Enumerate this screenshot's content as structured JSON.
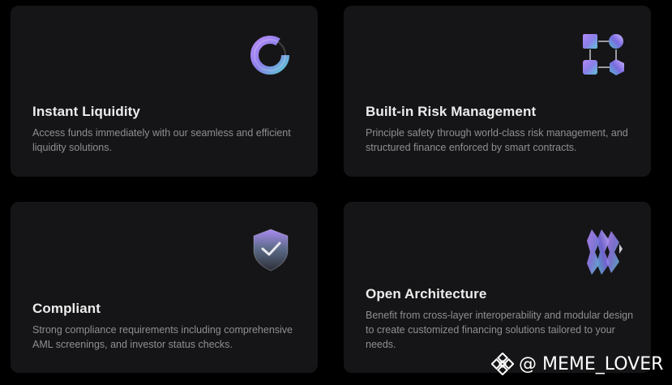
{
  "cards": [
    {
      "icon": "liquidity-ring-icon",
      "title": "Instant Liquidity",
      "description": "Access funds immediately with our seamless and efficient liquidity solutions."
    },
    {
      "icon": "risk-network-icon",
      "title": "Built-in Risk Management",
      "description": "Principle safety through world-class risk management, and structured finance enforced by smart contracts."
    },
    {
      "icon": "shield-check-icon",
      "title": "Compliant",
      "description": "Strong compliance requirements including comprehensive AML screenings, and investor status checks."
    },
    {
      "icon": "crystal-layers-icon",
      "title": "Open Architecture",
      "description": "Benefit from cross-layer interoperability and modular design to create customized financing solutions tailored to your needs."
    }
  ],
  "watermark": {
    "icon": "binance-logo-icon",
    "text": "@ MEME_LOVER"
  },
  "colors": {
    "background": "#000000",
    "card": "#151517",
    "title": "#ececec",
    "description": "#8f8f93",
    "gradient_purple": "#9b6cf0",
    "gradient_teal": "#63c4d9"
  }
}
